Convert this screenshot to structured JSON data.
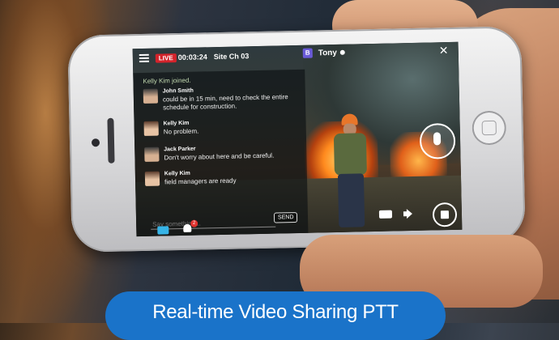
{
  "topbar": {
    "live_label": "LIVE",
    "timer": "00:03:24",
    "site": "Site Ch 03",
    "user_initial": "B",
    "user_name": "Tony",
    "close_icon": "✕"
  },
  "chat": {
    "joined_notice": "Kelly Kim joined.",
    "messages": [
      {
        "sender": "John Smith",
        "text": "could be in 15 min, need to check the entire schedule for construction."
      },
      {
        "sender": "Kelly Kim",
        "text": "No problem."
      },
      {
        "sender": "Jack Parker",
        "text": "Don't worry about here and be careful."
      },
      {
        "sender": "Kelly Kim",
        "text": "field managers are ready"
      }
    ],
    "input_placeholder": "Say something...",
    "send_label": "SEND",
    "users_count": "2"
  },
  "colors": {
    "live": "#d4232b",
    "accent": "#1a73c9",
    "chat_icon": "#36b3e6"
  },
  "icons": {
    "menu": "menu-icon",
    "close": "close-icon",
    "chat": "chat-bubble-icon",
    "users": "users-icon",
    "mic": "microphone-icon",
    "video": "video-camera-icon",
    "speaker": "speaker-icon",
    "stop": "stop-icon"
  },
  "caption": "Real-time Video Sharing PTT"
}
